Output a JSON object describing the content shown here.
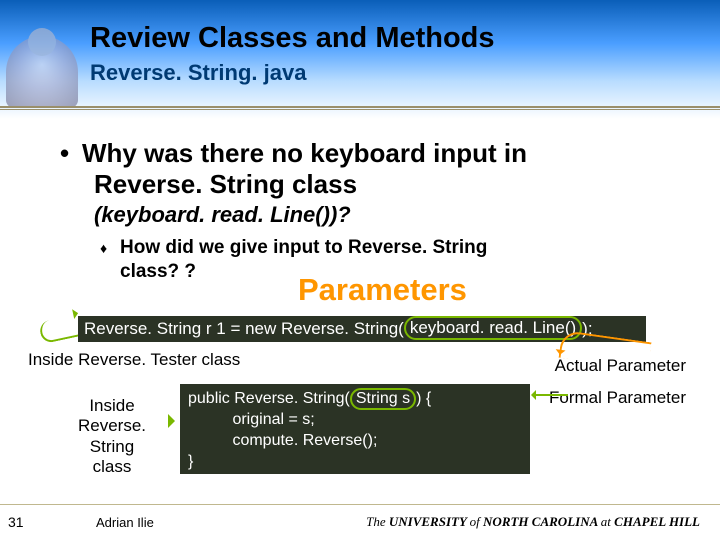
{
  "header": {
    "title": "Review Classes and Methods",
    "subtitle": "Reverse. String. java"
  },
  "body": {
    "bullet_line1": "Why was there no keyboard input in",
    "bullet_line2": "Reverse. String class",
    "question": "(keyboard. read. Line())?",
    "subbullet_line1": "How did we give input to Reverse. String",
    "subbullet_line2": "class? ?",
    "parameters_label": "Parameters"
  },
  "code1": {
    "prefix": "Reverse. String r 1 = new Reverse. String(",
    "arg": "keyboard. read. Line()",
    "suffix": ");"
  },
  "captions": {
    "tester": "Inside Reverse. Tester class",
    "actual": "Actual Parameter",
    "formal": "Formal Parameter",
    "inside_line1": "Inside",
    "inside_line2": "Reverse. String",
    "inside_line3": "class"
  },
  "code2": {
    "sig_prefix": "public Reverse. String(",
    "sig_arg": "String s",
    "sig_suffix": ") {",
    "l2": "          original = s;",
    "l3": "          compute. Reverse();",
    "l4": "}"
  },
  "footer": {
    "page": "31",
    "author": "Adrian Ilie",
    "univ_prefix": "The ",
    "univ_b1": "UNIVERSITY ",
    "univ_mid": "of ",
    "univ_b2": "NORTH CAROLINA ",
    "univ_suffix": "at ",
    "univ_b3": "CHAPEL HILL"
  }
}
